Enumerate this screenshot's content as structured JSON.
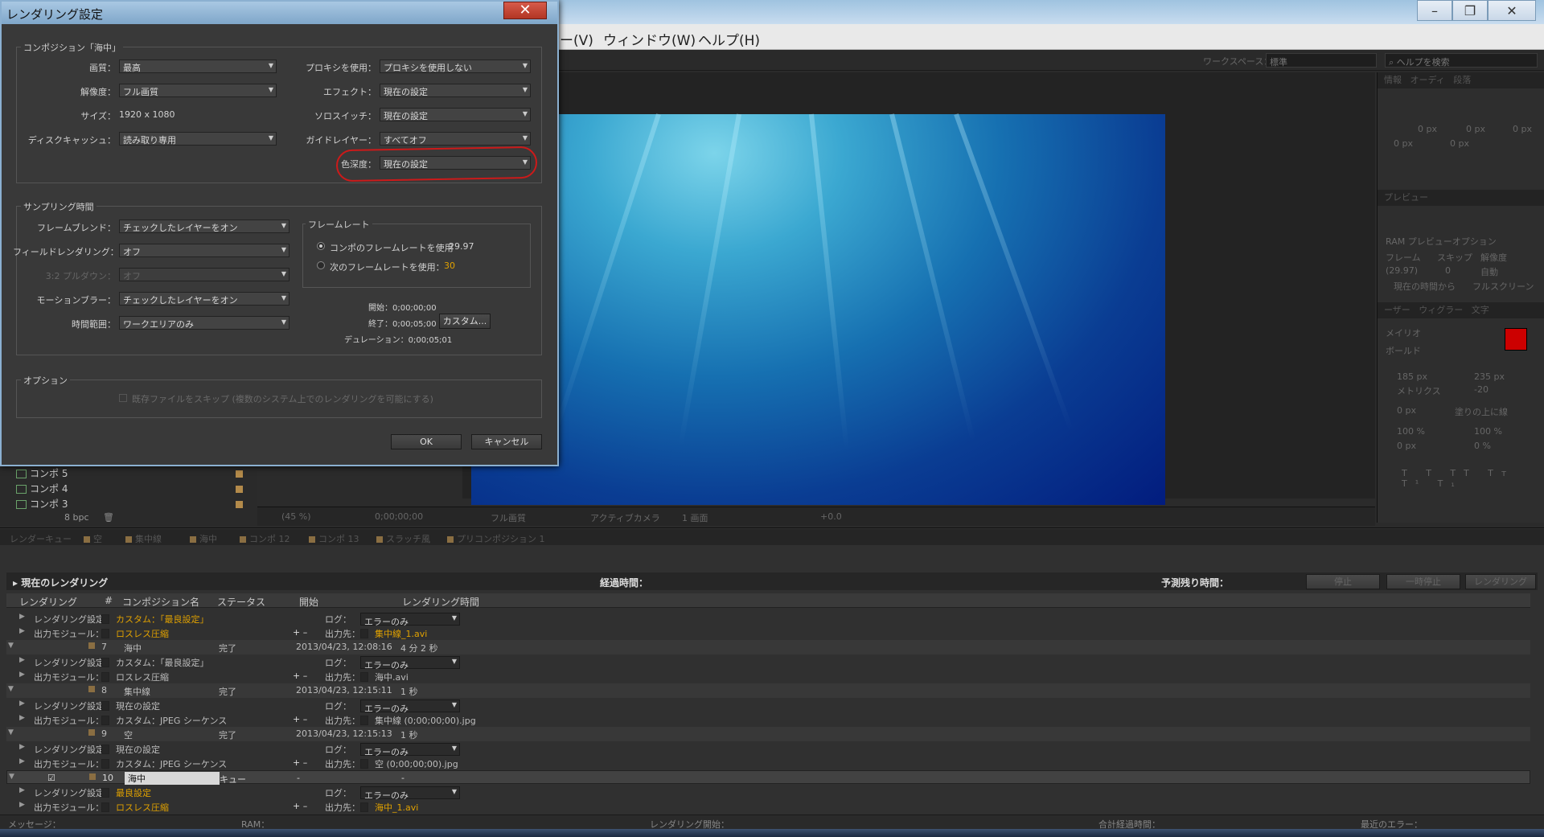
{
  "app": {
    "menu": [
      "ー(V)",
      "ウィンドウ(W)",
      "ヘルプ(H)"
    ],
    "workspace_label": "ワークスペース：",
    "workspace_value": "標準",
    "help_search_placeholder": "ヘルプを検索"
  },
  "right_panel": {
    "tabs_top": [
      "情報",
      "オーディ",
      "段落"
    ],
    "para_values": [
      "0 px",
      "0 px",
      "0 px",
      "0 px",
      "0 px"
    ],
    "preview_tab": "プレビュー",
    "ram_preview": "RAM プレビューオプション",
    "preview_labels": [
      "フレーム",
      "スキップ",
      "解像度"
    ],
    "preview_values": [
      "(29.97)",
      "0",
      "自動"
    ],
    "preview_checks": [
      "現在の時間から",
      "フルスクリーン"
    ],
    "tabs_char": [
      "ーザー",
      "ウィグラー",
      "文字"
    ],
    "font_name": "メイリオ",
    "font_style": "ボールド",
    "font_size": "185 px",
    "leading": "235 px",
    "kerning": "メトリクス",
    "tracking": "-20",
    "stroke": "0 px",
    "stroke_mode": "塗りの上に線",
    "vscale": "100 %",
    "hscale": "100 %",
    "baseline": "0 px",
    "tsume": "0 %",
    "fill_color": "#cc0000"
  },
  "viewer_toolbar": {
    "zoom": "(45 %)",
    "timecode": "0;00;00;00",
    "resolution": "フル画質",
    "camera": "アクティブカメラ",
    "view": "1 画面",
    "exposure": "+0.0"
  },
  "project": {
    "items": [
      "コンポ 5",
      "コンポ 4",
      "コンポ 3"
    ],
    "bpc": "8 bpc"
  },
  "render_queue": {
    "tabs": [
      "レンダーキュー",
      "空",
      "集中線",
      "海中",
      "コンポ 12",
      "コンポ 13",
      "スラッチ風",
      "プリコンポジション 1"
    ],
    "current_render": "現在のレンダリング",
    "elapsed_label": "経過時間：",
    "remaining_label": "予測残り時間：",
    "btn_stop": "停止",
    "btn_pause": "一時停止",
    "btn_render": "レンダリング",
    "columns": [
      "レンダリング",
      "#",
      "コンポジション名",
      "ステータス",
      "開始",
      "レンダリング時間"
    ],
    "rows": [
      {
        "kind": "setting",
        "label": "レンダリング設定：",
        "value": "カスタム：「最良設定」",
        "orange": true,
        "right_label": "ログ：",
        "right_value": "エラーのみ"
      },
      {
        "kind": "output",
        "label": "出力モジュール：",
        "value": "ロスレス圧縮",
        "orange": true,
        "right_label": "出力先：",
        "right_value": "集中線_1.avi"
      },
      {
        "kind": "item",
        "num": "7",
        "name": "海中",
        "status": "完了",
        "start": "2013/04/23, 12:08:16",
        "time": "4 分 2 秒"
      },
      {
        "kind": "setting",
        "label": "レンダリング設定：",
        "value": "カスタム：「最良設定」",
        "orange": false,
        "right_label": "ログ：",
        "right_value": "エラーのみ"
      },
      {
        "kind": "output",
        "label": "出力モジュール：",
        "value": "ロスレス圧縮",
        "orange": false,
        "right_label": "出力先：",
        "right_value": "海中.avi"
      },
      {
        "kind": "item",
        "num": "8",
        "name": "集中線",
        "status": "完了",
        "start": "2013/04/23, 12:15:11",
        "time": "1 秒"
      },
      {
        "kind": "setting",
        "label": "レンダリング設定：",
        "value": "現在の設定",
        "orange": false,
        "right_label": "ログ：",
        "right_value": "エラーのみ"
      },
      {
        "kind": "output",
        "label": "出力モジュール：",
        "value": "カスタム：JPEG シーケンス",
        "orange": false,
        "right_label": "出力先：",
        "right_value": "集中線 (0;00;00;00).jpg"
      },
      {
        "kind": "item",
        "num": "9",
        "name": "空",
        "status": "完了",
        "start": "2013/04/23, 12:15:13",
        "time": "1 秒"
      },
      {
        "kind": "setting",
        "label": "レンダリング設定：",
        "value": "現在の設定",
        "orange": false,
        "right_label": "ログ：",
        "right_value": "エラーのみ"
      },
      {
        "kind": "output",
        "label": "出力モジュール：",
        "value": "カスタム：JPEG シーケンス",
        "orange": false,
        "right_label": "出力先：",
        "right_value": "空 (0;00;00;00).jpg"
      },
      {
        "kind": "active",
        "num": "10",
        "name": "海中",
        "status": "キュー",
        "start": "-",
        "time": "-"
      },
      {
        "kind": "setting",
        "label": "レンダリング設定：",
        "value": "最良設定",
        "orange": true,
        "right_label": "ログ：",
        "right_value": "エラーのみ"
      },
      {
        "kind": "output",
        "label": "出力モジュール：",
        "value": "ロスレス圧縮",
        "orange": true,
        "right_label": "出力先：",
        "right_value": "海中_1.avi"
      }
    ],
    "status_bar": [
      "メッセージ：",
      "RAM：",
      "レンダリング開始：",
      "合計経過時間：",
      "最近のエラー："
    ]
  },
  "dialog": {
    "title": "レンダリング設定",
    "comp_group": "コンポジション「海中」",
    "quality_label": "画質：",
    "quality": "最高",
    "resolution_label": "解像度：",
    "resolution": "フル画質",
    "size_label": "サイズ：",
    "size": "1920 x 1080",
    "disk_label": "ディスクキャッシュ：",
    "disk": "読み取り専用",
    "proxy_label": "プロキシを使用：",
    "proxy": "プロキシを使用しない",
    "effect_label": "エフェクト：",
    "effect": "現在の設定",
    "solo_label": "ソロスイッチ：",
    "solo": "現在の設定",
    "guide_label": "ガイドレイヤー：",
    "guide": "すべてオフ",
    "depth_label": "色深度：",
    "depth": "現在の設定",
    "sampling_group": "サンプリング時間",
    "frameblend_label": "フレームブレンド：",
    "frameblend": "チェックしたレイヤーをオン",
    "field_label": "フィールドレンダリング：",
    "field": "オフ",
    "pulldown_label": "3:2 プルダウン：",
    "pulldown": "オフ",
    "motionblur_label": "モーションブラー：",
    "motionblur": "チェックしたレイヤーをオン",
    "timerange_label": "時間範囲：",
    "timerange": "ワークエリアのみ",
    "framerate_group": "フレームレート",
    "use_comp_rate": "コンポのフレームレートを使用",
    "comp_rate": "29.97",
    "use_rate": "次のフレームレートを使用：",
    "rate": "30",
    "start_label": "開始：0;00;00;00",
    "end_label": "終了：0;00;05;00",
    "duration_label": "デュレーション：0;00;05;01",
    "custom_btn": "カスタム...",
    "options_group": "オプション",
    "skip_existing": "既存ファイルをスキップ (複数のシステム上でのレンダリングを可能にする)",
    "ok": "OK",
    "cancel": "キャンセル"
  }
}
